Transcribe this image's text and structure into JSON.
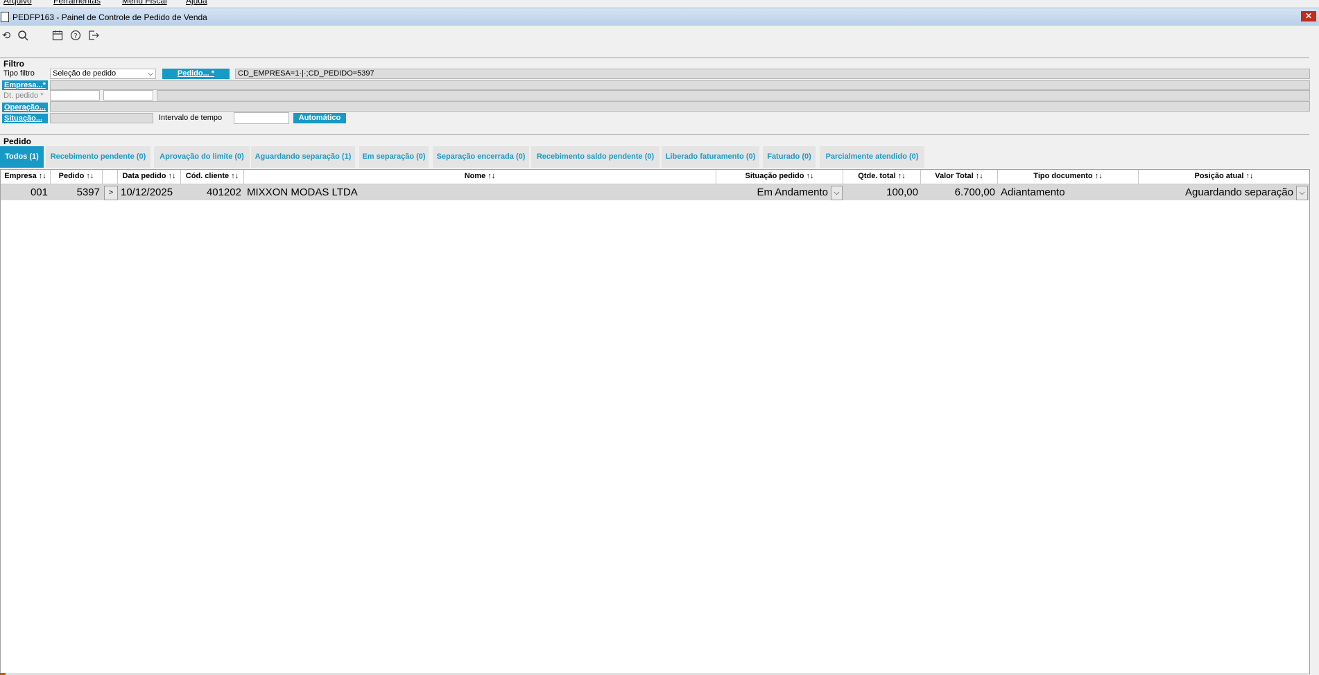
{
  "menu": [
    "Arquivo",
    "Ferramentas",
    "Menu Fiscal",
    "Ajuda"
  ],
  "window": {
    "title": "PEDFP163 - Painel de Controle de Pedido de Venda",
    "close_label": "✕"
  },
  "toolbar": {
    "icons": [
      "refresh-icon",
      "search-icon",
      "calendar-icon",
      "help-icon",
      "exit-icon"
    ]
  },
  "filter": {
    "section_label": "Filtro",
    "tipo_filtro_label": "Tipo filtro",
    "tipo_filtro_value": "Seleção de pedido",
    "pedido_button": "Pedido... *",
    "pedido_value": "CD_EMPRESA=1·|·;CD_PEDIDO=5397",
    "empresa_button": "Empresa...*",
    "dt_pedido_label": "Dt. pedido *",
    "operacao_button": "Operação...",
    "situacao_button": "Situação...",
    "intervalo_label": "Intervalo de tempo",
    "automatico_button": "Automático"
  },
  "pedido_section": {
    "label": "Pedido"
  },
  "tabs": [
    "Todos (1)",
    "Recebimento pendente (0)",
    "Aprovação do limite (0)",
    "Aguardando separação (1)",
    "Em separação (0)",
    "Separação encerrada (0)",
    "Recebimento saldo pendente (0)",
    "Liberado faturamento (0)",
    "Faturado (0)",
    "Parcialmente atendido (0)"
  ],
  "grid": {
    "columns": [
      "Empresa ↑↓",
      "Pedido ↑↓",
      "",
      "Data pedido ↑↓",
      "Cód. cliente ↑↓",
      "Nome ↑↓",
      "Situação pedido ↑↓",
      "Qtde. total ↑↓",
      "Valor Total ↑↓",
      "Tipo documento ↑↓",
      "Posição atual ↑↓"
    ],
    "rows": [
      {
        "empresa": "001",
        "pedido": "5397",
        "expand": ">",
        "data_pedido": "10/12/2025",
        "cod_cliente": "401202",
        "nome": "MIXXON MODAS LTDA",
        "situacao": "Em Andamento",
        "qtde_total": "100,00",
        "valor_total": "6.700,00",
        "tipo_documento": "Adiantamento",
        "posicao_atual": "Aguardando separação"
      }
    ]
  },
  "colors": {
    "accent": "#1899c6",
    "row_bg": "#d8d8d8",
    "close": "#c42b1c"
  }
}
